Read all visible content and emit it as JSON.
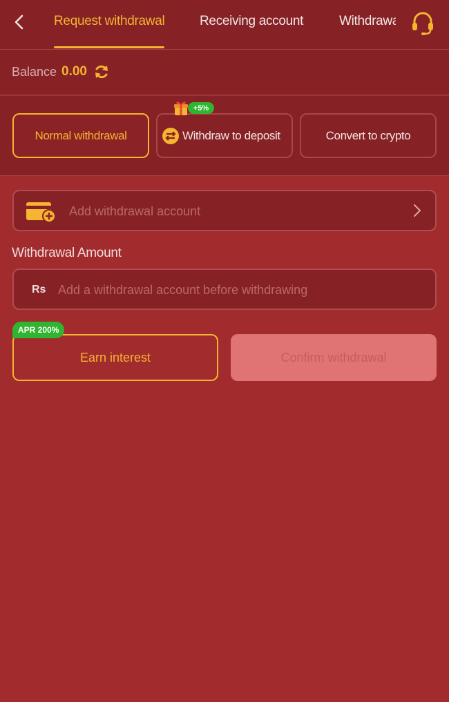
{
  "header": {
    "tabs": [
      {
        "label": "Request withdrawal",
        "active": true
      },
      {
        "label": "Receiving account",
        "active": false
      },
      {
        "label": "Withdrawal",
        "active": false
      }
    ]
  },
  "balance": {
    "label": "Balance",
    "value": "0.00"
  },
  "methods": [
    {
      "label": "Normal withdrawal",
      "active": true
    },
    {
      "label": "Withdraw to deposit",
      "active": false,
      "bonus": "+5%"
    },
    {
      "label": "Convert to crypto",
      "active": false
    }
  ],
  "account": {
    "label": "Add withdrawal account"
  },
  "amount": {
    "label": "Withdrawal Amount",
    "currency": "Rs",
    "placeholder": "Add a withdrawal account before withdrawing"
  },
  "actions": {
    "apr_badge": "APR 200%",
    "earn_label": "Earn interest",
    "confirm_label": "Confirm withdrawal"
  },
  "colors": {
    "background": "#a22b2e",
    "panel": "#862225",
    "accent": "#f5b431",
    "badge_green": "#2fb52f"
  }
}
